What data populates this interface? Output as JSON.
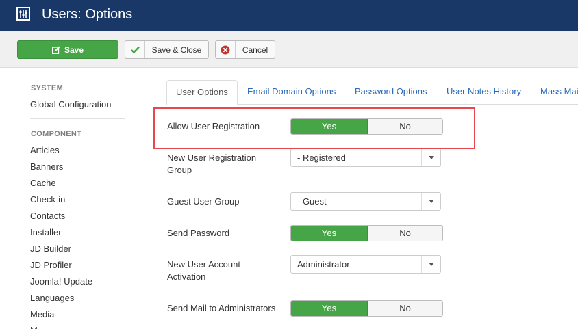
{
  "header": {
    "title": "Users: Options",
    "icon": "options-sliders-icon",
    "bg_color": "#1a3867"
  },
  "toolbar": {
    "save_label": "Save",
    "save_close_label": "Save & Close",
    "cancel_label": "Cancel",
    "save_color": "#46a546"
  },
  "sidebar": {
    "sections": [
      {
        "heading": "SYSTEM",
        "items": [
          "Global Configuration"
        ]
      },
      {
        "heading": "COMPONENT",
        "items": [
          "Articles",
          "Banners",
          "Cache",
          "Check-in",
          "Contacts",
          "Installer",
          "JD Builder",
          "JD Profiler",
          "Joomla! Update",
          "Languages",
          "Media",
          "M"
        ]
      }
    ]
  },
  "tabs": [
    {
      "label": "User Options",
      "active": true
    },
    {
      "label": "Email Domain Options",
      "active": false
    },
    {
      "label": "Password Options",
      "active": false
    },
    {
      "label": "User Notes History",
      "active": false
    },
    {
      "label": "Mass Mai",
      "active": false
    }
  ],
  "form": {
    "allow_registration": {
      "label": "Allow User Registration",
      "yes": "Yes",
      "no": "No",
      "value": "Yes"
    },
    "new_user_group": {
      "label": "New User Registration Group",
      "value": "- Registered"
    },
    "guest_group": {
      "label": "Guest User Group",
      "value": "- Guest"
    },
    "send_password": {
      "label": "Send Password",
      "yes": "Yes",
      "no": "No",
      "value": "Yes"
    },
    "account_activation": {
      "label": "New User Account Activation",
      "value": "Administrator"
    },
    "mail_admins": {
      "label": "Send Mail to Administrators",
      "yes": "Yes",
      "no": "No",
      "value": "Yes"
    }
  },
  "colors": {
    "accent_green": "#46a546",
    "link_blue": "#2a69b8",
    "highlight_red": "#e8474f"
  }
}
